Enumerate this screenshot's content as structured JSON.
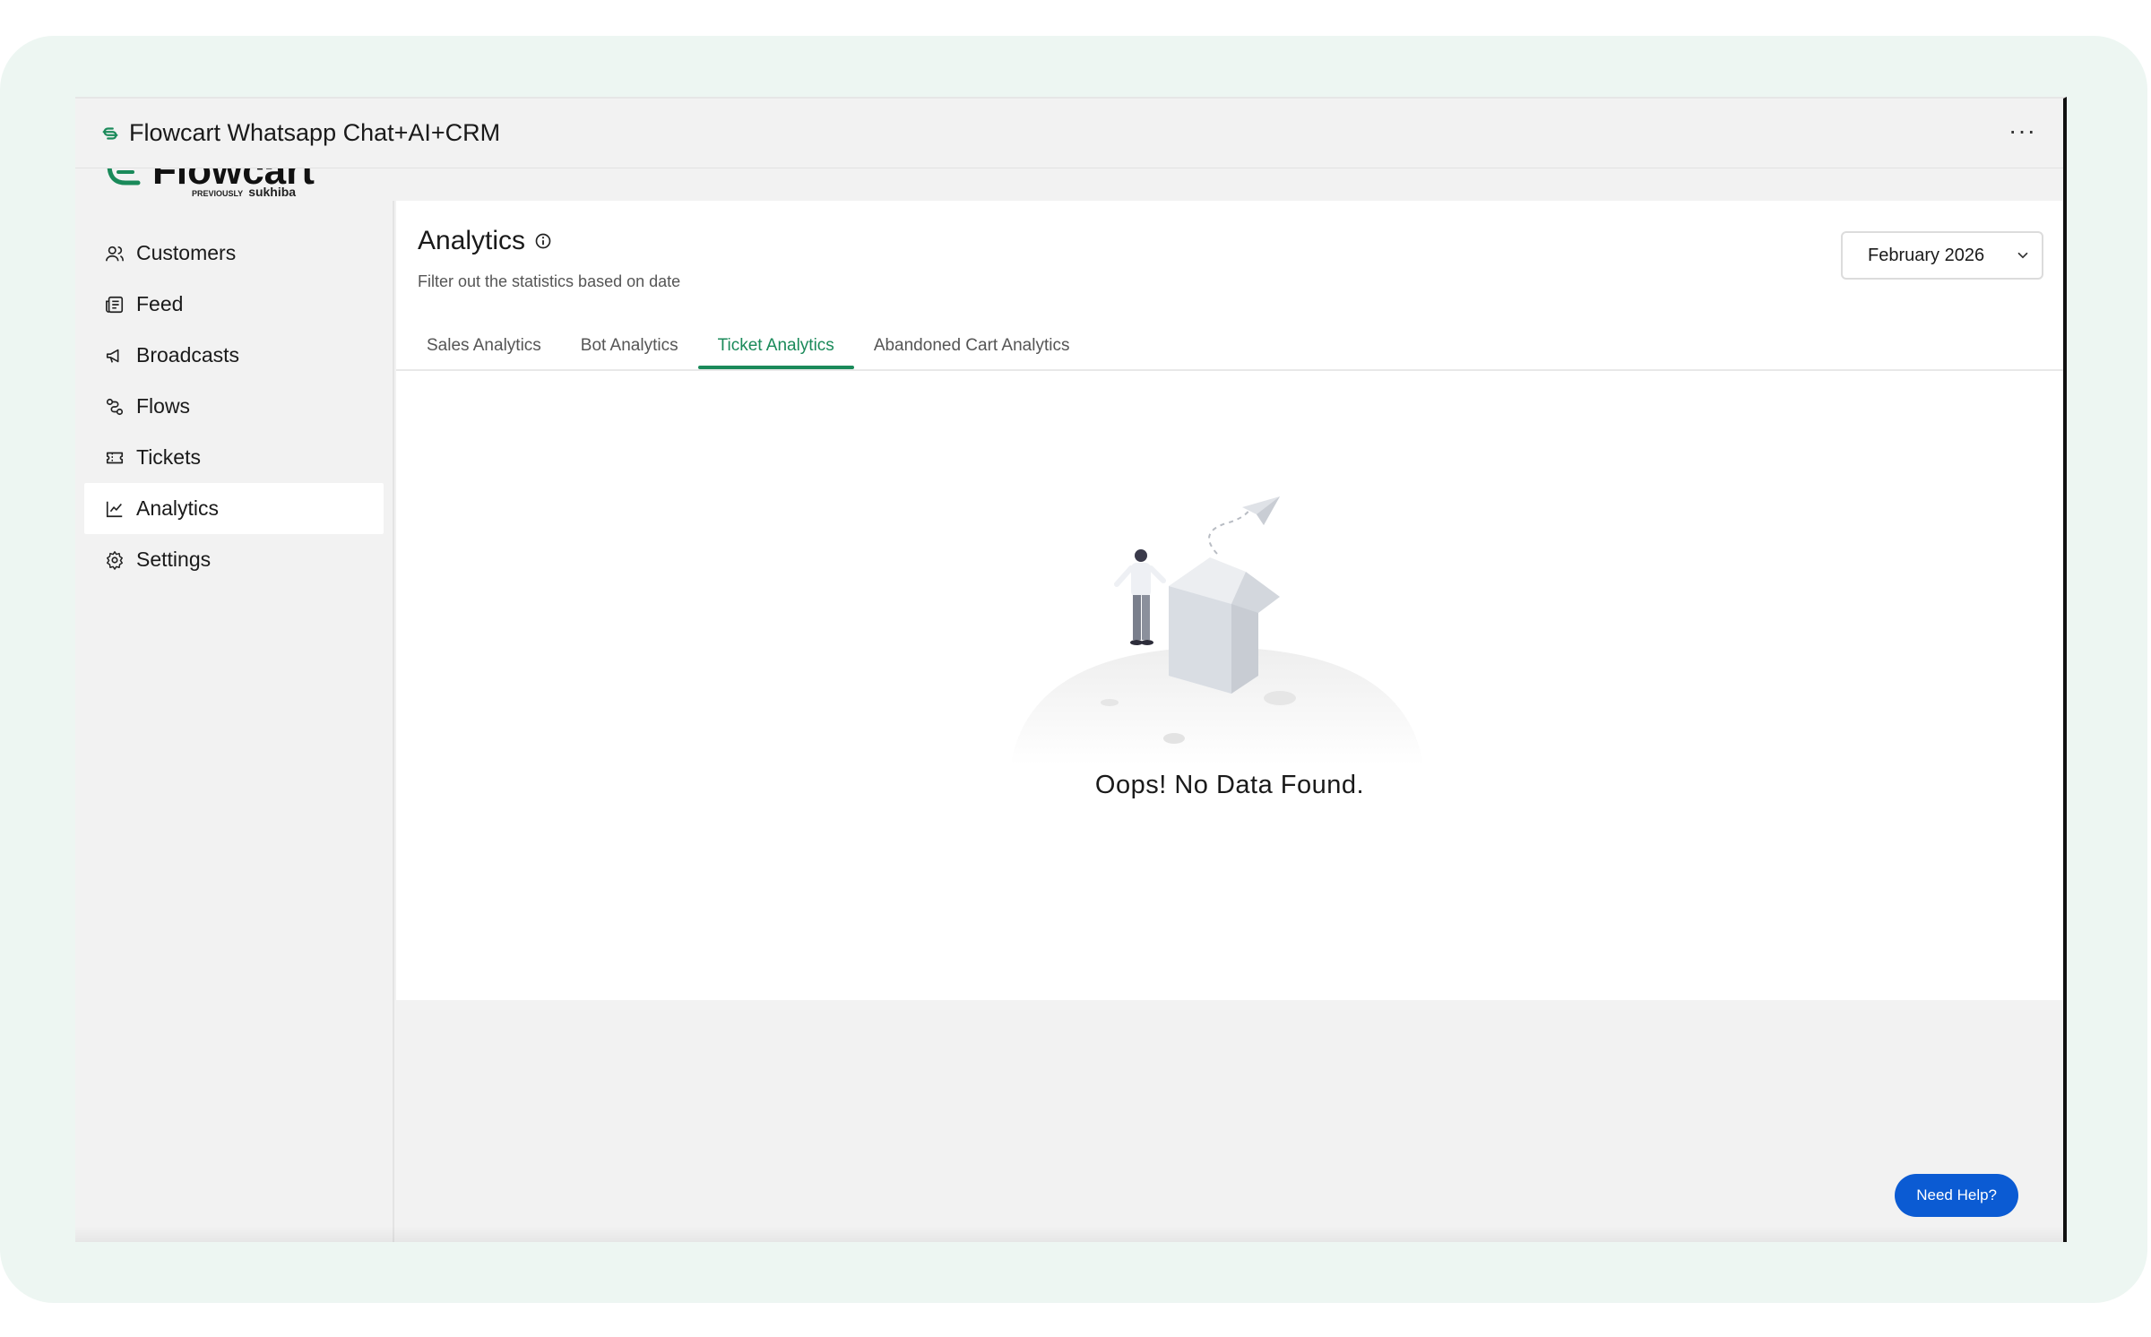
{
  "window": {
    "title": "Flowcart Whatsapp Chat+AI+CRM",
    "menu_icon": "ellipsis-icon"
  },
  "brand": {
    "logo_text": "Flowcart",
    "previously_label": "PREVIOUSLY",
    "previous_name": "sukhiba",
    "brand_color": "#1a8a5a"
  },
  "sidebar": {
    "items": [
      {
        "label": "Customers",
        "icon": "users-icon",
        "active": false
      },
      {
        "label": "Feed",
        "icon": "newspaper-icon",
        "active": false
      },
      {
        "label": "Broadcasts",
        "icon": "megaphone-icon",
        "active": false
      },
      {
        "label": "Flows",
        "icon": "flow-icon",
        "active": false
      },
      {
        "label": "Tickets",
        "icon": "ticket-icon",
        "active": false
      },
      {
        "label": "Analytics",
        "icon": "chart-line-icon",
        "active": true
      },
      {
        "label": "Settings",
        "icon": "gear-icon",
        "active": false
      }
    ]
  },
  "page": {
    "title": "Analytics",
    "subtitle": "Filter out the statistics based on date",
    "date_filter": "February 2026",
    "tabs": [
      {
        "label": "Sales Analytics",
        "active": false
      },
      {
        "label": "Bot Analytics",
        "active": false
      },
      {
        "label": "Ticket Analytics",
        "active": true
      },
      {
        "label": "Abandoned Cart Analytics",
        "active": false
      }
    ],
    "empty_message": "Oops! No Data Found."
  },
  "help": {
    "label": "Need Help?",
    "color": "#0b5bd3"
  }
}
